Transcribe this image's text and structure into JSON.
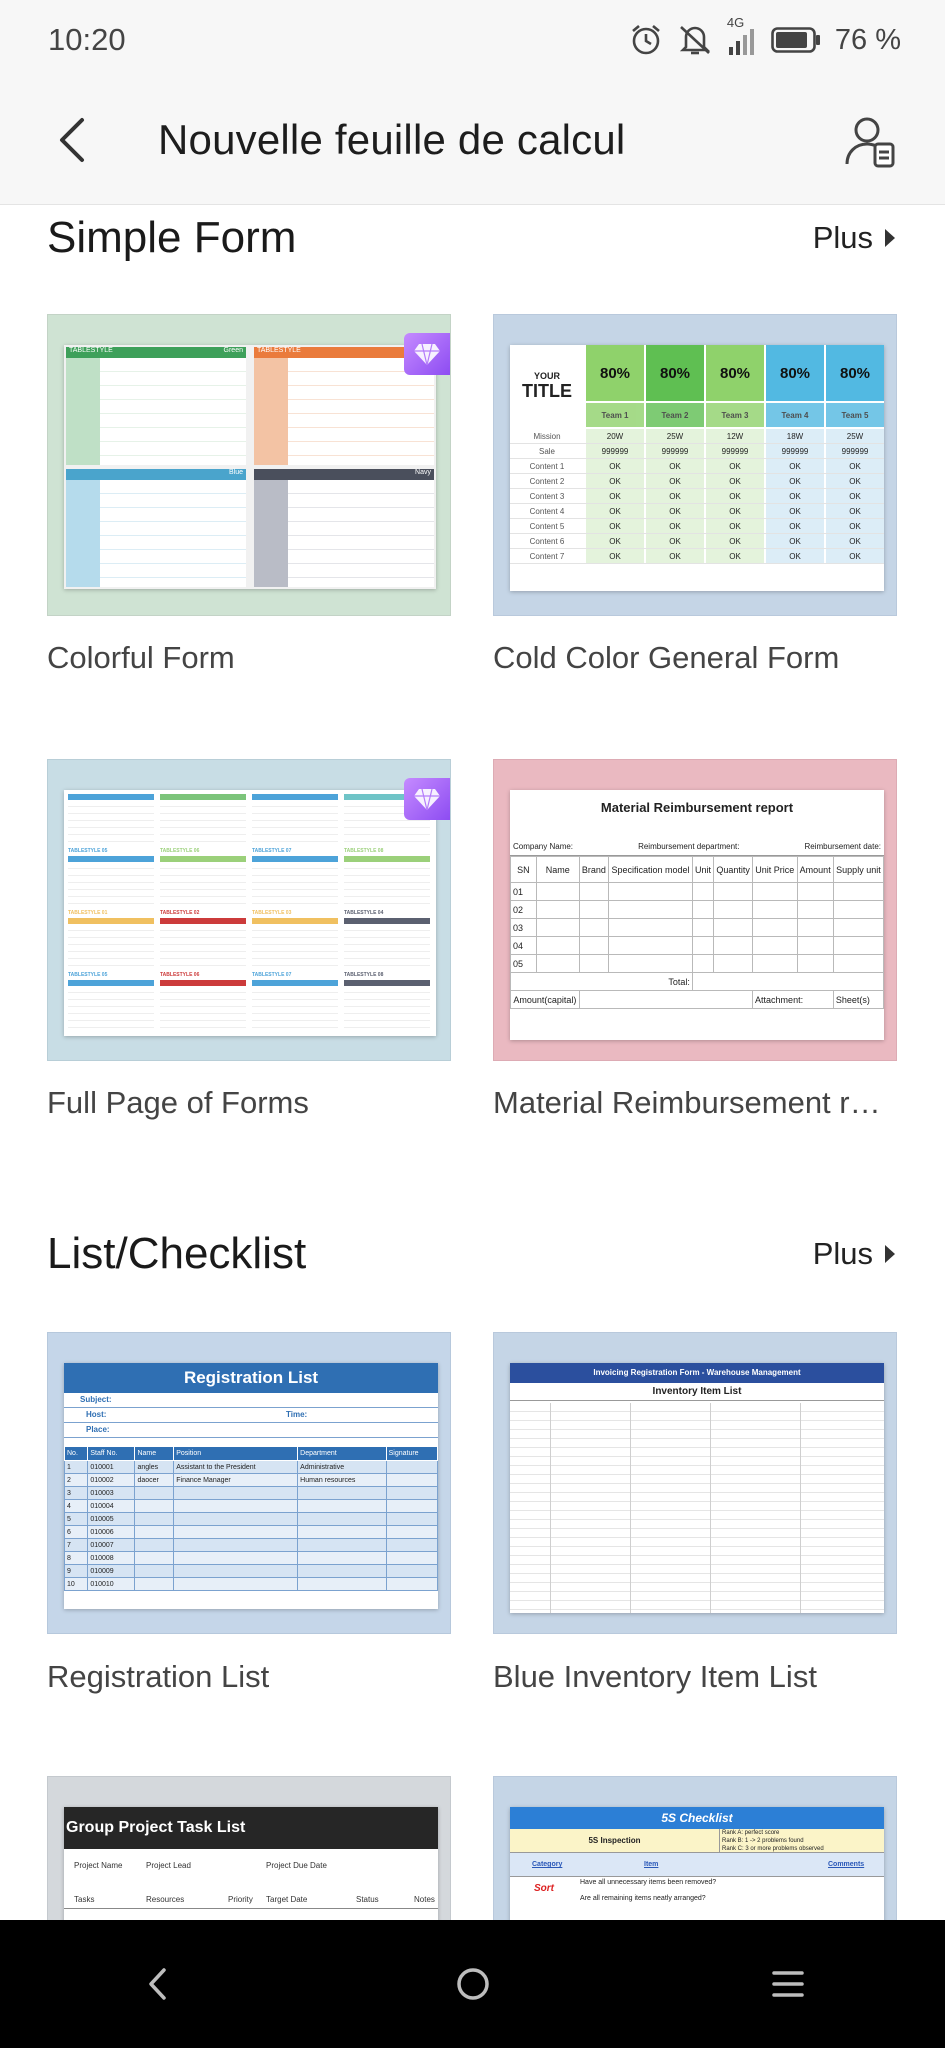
{
  "status_bar": {
    "time": "10:20",
    "network": "4G",
    "battery": "76 %",
    "icons": [
      "alarm-icon",
      "mute-icon",
      "signal-icon",
      "battery-icon"
    ]
  },
  "header": {
    "title": "Nouvelle feuille de calcul",
    "back_icon": "back-arrow-icon",
    "account_icon": "account-icon"
  },
  "sections": [
    {
      "title": "Simple Form",
      "more": "Plus",
      "templates": [
        {
          "label": "Colorful Form",
          "premium": true
        },
        {
          "label": "Cold Color General Form",
          "premium": false
        },
        {
          "label": "Full Page of Forms",
          "premium": true
        },
        {
          "label": "Material Reimbursement report",
          "premium": false
        }
      ]
    },
    {
      "title": "List/Checklist",
      "more": "Plus",
      "templates": [
        {
          "label": "Registration List",
          "premium": false
        },
        {
          "label": "Blue Inventory Item List",
          "premium": false
        },
        {
          "label": "Group Project Task List",
          "premium": false
        },
        {
          "label": "5S Checklist",
          "premium": false
        }
      ]
    }
  ],
  "thumbs": {
    "colorful": {
      "blocks": [
        "Green",
        "TABLESTYLE",
        "Blue",
        "Navy"
      ]
    },
    "cold": {
      "your": "YOUR",
      "title": "TITLE",
      "teams": [
        "Team 1",
        "Team 2",
        "Team 3",
        "Team 4",
        "Team 5"
      ],
      "pct": "80%",
      "mission_label": "Mission",
      "mission": [
        "20W",
        "25W",
        "12W",
        "18W",
        "25W"
      ],
      "sale_label": "Sale",
      "sale": "999999",
      "rows": [
        "Content 1",
        "Content 2",
        "Content 3",
        "Content 4",
        "Content 5",
        "Content 6",
        "Content 7"
      ]
    },
    "fullpage": {
      "labels": [
        "TABLESTYLE 01",
        "TABLESTYLE 02",
        "TABLESTYLE 03",
        "TABLESTYLE 04",
        "TABLESTYLE 05",
        "TABLESTYLE 06",
        "TABLESTYLE 07",
        "TABLESTYLE 08"
      ]
    },
    "material": {
      "title": "Material Reimbursement report",
      "company": "Company Name:",
      "dept": "Reimbursement department:",
      "date": "Reimbursement date:",
      "cols": [
        "SN",
        "Name",
        "Brand",
        "Specification model",
        "Unit",
        "Quantity",
        "Unit Price",
        "Amount",
        "Supply unit"
      ],
      "rows": [
        "01",
        "02",
        "03",
        "04",
        "05"
      ],
      "total": "Total:",
      "amount": "Amount(capital)",
      "attachment": "Attachment:",
      "sheets": "Sheet(s)"
    },
    "registration": {
      "title": "Registration List",
      "subject": "Subject:",
      "host": "Host:",
      "time": "Time:",
      "place": "Place:",
      "cols": [
        "No.",
        "Staff No.",
        "Name",
        "Position",
        "Department",
        "Signature"
      ],
      "rows": [
        [
          "1",
          "010001",
          "angles",
          "Assistant to the President",
          "Administrative"
        ],
        [
          "2",
          "010002",
          "daocer",
          "Finance Manager",
          "Human resources"
        ],
        [
          "3",
          "010003",
          "",
          "",
          ""
        ],
        [
          "4",
          "010004",
          "",
          "",
          ""
        ],
        [
          "5",
          "010005",
          "",
          "",
          ""
        ],
        [
          "6",
          "010006",
          "",
          "",
          ""
        ],
        [
          "7",
          "010007",
          "",
          "",
          ""
        ],
        [
          "8",
          "010008",
          "",
          "",
          ""
        ],
        [
          "9",
          "010009",
          "",
          "",
          ""
        ],
        [
          "10",
          "010010",
          "",
          "",
          ""
        ]
      ]
    },
    "inventory": {
      "banner": "Invoicing Registration Form - Warehouse Management",
      "title": "Inventory Item List"
    },
    "group": {
      "title": "Group Project Task List",
      "project_name": "Project Name",
      "project_lead": "Project Lead",
      "due": "Project Due Date",
      "tasks": "Tasks",
      "resources": "Resources",
      "priority": "Priority",
      "target": "Target Date",
      "status": "Status",
      "notes": "Notes"
    },
    "checklist": {
      "title": "5S Checklist",
      "inspection": "5S Inspection",
      "rank_a": "Rank A: perfect score",
      "rank_b": "Rank B: 1 -> 2 problems found",
      "rank_c": "Rank C: 3 or more problems observed",
      "category": "Category",
      "item": "Item",
      "comments": "Comments",
      "sort": "Sort",
      "q1": "Have all unnecessary items been removed?",
      "q2": "Are all remaining items neatly arranged?"
    }
  },
  "nav": {
    "back": "nav-back-icon",
    "home": "nav-home-icon",
    "menu": "nav-menu-icon"
  },
  "colors": {
    "premium": "#9b59f5",
    "header_bg": "#f7f7f7",
    "nav_bg": "#000000"
  }
}
